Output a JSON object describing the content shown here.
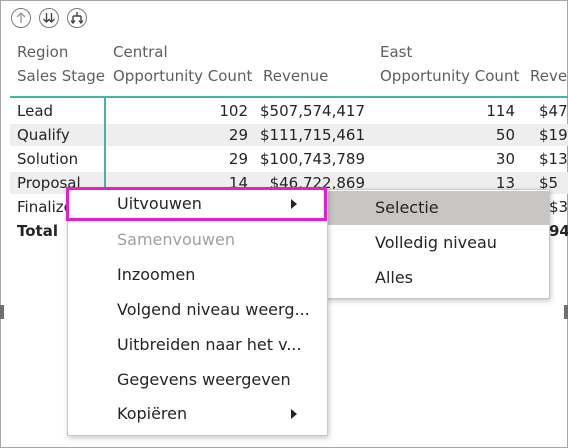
{
  "toolbar": {
    "drill_up_icon": "arrow-up-circle-icon",
    "drill_down_icon": "double-arrow-down-circle-icon",
    "expand_all_icon": "fork-down-circle-icon"
  },
  "matrix": {
    "row_header_1": "Region",
    "row_header_2": "Sales Stage",
    "groups": [
      {
        "name": "Central",
        "col1": "Opportunity Count",
        "col2": "Revenue"
      },
      {
        "name": "East",
        "col1": "Opportunity Count",
        "col2": "Reven"
      }
    ],
    "rows": [
      {
        "label": "Lead",
        "c_count": "102",
        "c_rev": "$507,574,417",
        "e_count": "114",
        "e_rev": "$47"
      },
      {
        "label": "Qualify",
        "c_count": "29",
        "c_rev": "$111,715,461",
        "e_count": "50",
        "e_rev": "$19"
      },
      {
        "label": "Solution",
        "c_count": "29",
        "c_rev": "$100,743,789",
        "e_count": "30",
        "e_rev": "$13"
      },
      {
        "label": "Proposal",
        "c_count": "14",
        "c_rev": "$46,722,869",
        "e_count": "13",
        "e_rev": "$5"
      },
      {
        "label": "Finalize",
        "c_count": "",
        "c_rev": "",
        "e_count": "",
        "e_rev": "$3"
      },
      {
        "label": "Total",
        "c_count": "",
        "c_rev": "",
        "e_count": "",
        "e_rev": "94"
      }
    ]
  },
  "context_menu": {
    "items": [
      {
        "label": "Uitvouwen",
        "has_submenu": true,
        "disabled": false
      },
      {
        "label": "Samenvouwen",
        "has_submenu": false,
        "disabled": true
      },
      {
        "label": "Inzoomen",
        "has_submenu": false,
        "disabled": false
      },
      {
        "label": "Volgend niveau weerg...",
        "has_submenu": false,
        "disabled": false
      },
      {
        "label": "Uitbreiden naar het v...",
        "has_submenu": false,
        "disabled": false
      },
      {
        "label": "Gegevens weergeven",
        "has_submenu": false,
        "disabled": false
      },
      {
        "label": "Kopiëren",
        "has_submenu": true,
        "disabled": false
      }
    ]
  },
  "submenu": {
    "items": [
      {
        "label": "Selectie",
        "selected": true
      },
      {
        "label": "Volledig niveau",
        "selected": false
      },
      {
        "label": "Alles",
        "selected": false
      }
    ]
  },
  "colors": {
    "highlight_border": "#e81cd0",
    "teal_divider": "#46b3a7",
    "selected_bg": "#c8c6c4"
  }
}
